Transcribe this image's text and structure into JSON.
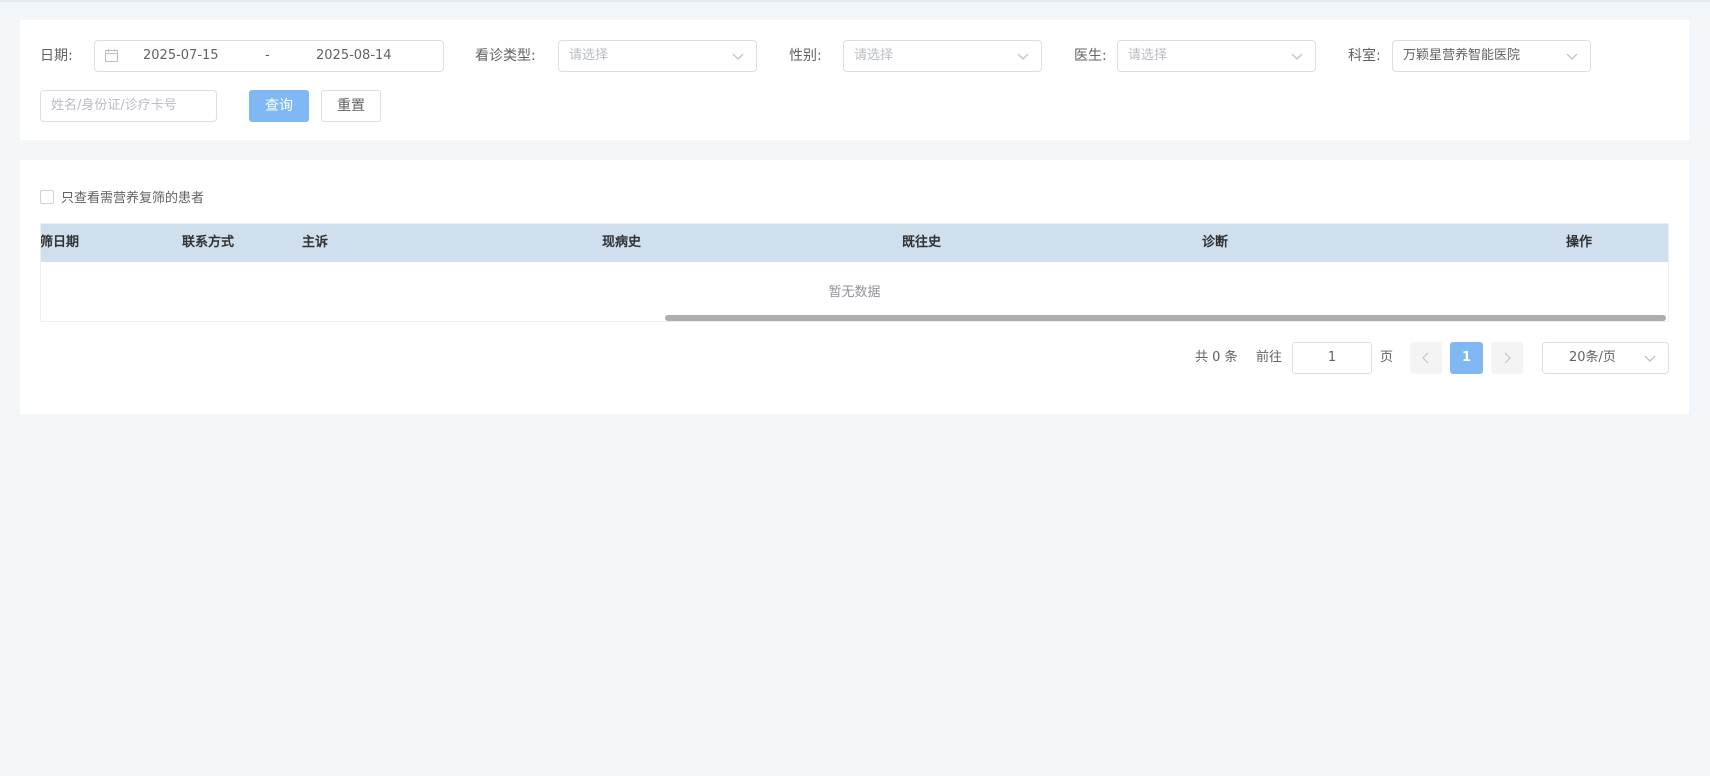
{
  "filters": {
    "date_label": "日期:",
    "date_start": "2025-07-15",
    "date_separator": "-",
    "date_end": "2025-08-14",
    "visit_type_label": "看诊类型:",
    "visit_type_placeholder": "请选择",
    "gender_label": "性别:",
    "gender_placeholder": "请选择",
    "doctor_label": "医生:",
    "doctor_placeholder": "请选择",
    "department_label": "科室:",
    "department_value": "万颖星营养智能医院",
    "search_placeholder": "姓名/身份证/诊疗卡号",
    "query_button": "查询",
    "reset_button": "重置"
  },
  "table": {
    "filter_checkbox_label": "只查看需营养复筛的患者",
    "columns": [
      "复筛日期",
      "联系方式",
      "主诉",
      "现病史",
      "既往史",
      "诊断",
      "操作"
    ],
    "empty_text": "暂无数据"
  },
  "pagination": {
    "total_text": "共 0 条",
    "goto_label": "前往",
    "goto_value": "1",
    "page_suffix": "页",
    "current_page": "1",
    "page_size": "20条/页",
    "prev_icon": "chevron-left-icon",
    "next_icon": "chevron-right-icon"
  },
  "colors": {
    "primary": "#7fb8f2",
    "header_bg": "#cfdfee",
    "page_bg": "#f3f6f9"
  }
}
